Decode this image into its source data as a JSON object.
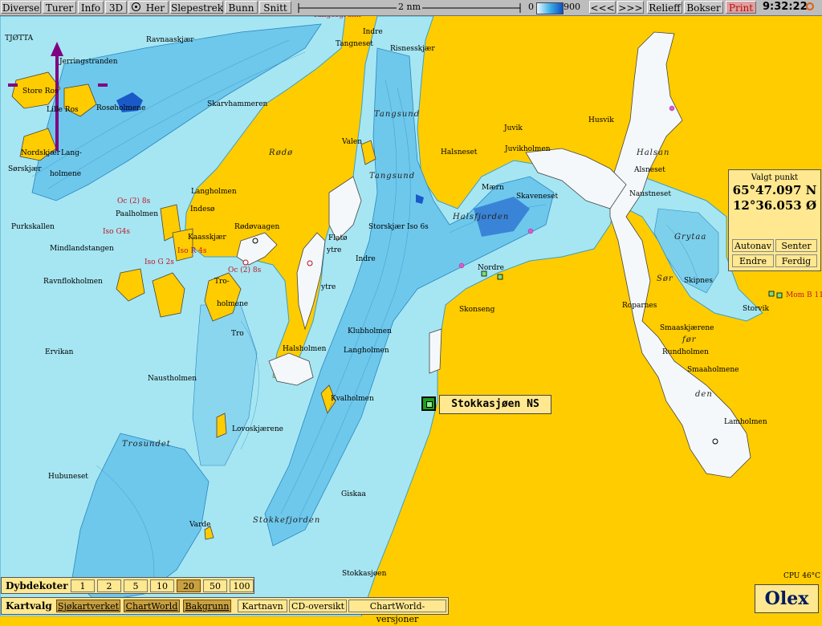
{
  "toolbar": {
    "items": [
      "Diverse",
      "Turer",
      "Info",
      "3D",
      "Her",
      "Slepestrek",
      "Bunn",
      "Snitt"
    ],
    "scale_label": "2 nm",
    "depth_min": "0",
    "depth_max": "900",
    "prev": "<<<",
    "next": ">>>",
    "relieff": "Relieff",
    "bokser": "Bokser",
    "print": "Print",
    "clock": "9:32:22"
  },
  "valgt_punkt": {
    "title": "Valgt punkt",
    "lat": "65°47.097 N",
    "lon": "12°36.053 Ø",
    "autonav": "Autonav",
    "senter": "Senter",
    "endre": "Endre",
    "ferdig": "Ferdig"
  },
  "waypoint": {
    "label": "Stokkasjøen NS"
  },
  "dybdekoter": {
    "label": "Dybdekoter",
    "values": [
      "1",
      "2",
      "5",
      "10",
      "20",
      "50",
      "100"
    ]
  },
  "kartvalg": {
    "label": "Kartvalg",
    "sources": [
      "Sjøkartverket",
      "ChartWorld",
      "Bakgrunn"
    ],
    "links": [
      "Kartnavn",
      "CD-oversikt",
      "ChartWorld-versjoner"
    ]
  },
  "cpu": "CPU 46°C",
  "logo": "Olex",
  "map_labels": [
    {
      "t": "TJØTTA",
      "s": "n"
    },
    {
      "t": "Ravnaaskjær",
      "s": "n"
    },
    {
      "t": "Indre",
      "s": "n"
    },
    {
      "t": "Tangneset",
      "s": "n"
    },
    {
      "t": "Risnesskjær",
      "s": "n"
    },
    {
      "t": "Jerringstranden",
      "s": "n"
    },
    {
      "t": "Store Ros",
      "s": "n"
    },
    {
      "t": "Lille Ros",
      "s": "n"
    },
    {
      "t": "Rosøholmene",
      "s": "n"
    },
    {
      "t": "Skarvhammeren",
      "s": "n"
    },
    {
      "t": "Tangsund",
      "s": "i"
    },
    {
      "t": "Juvik",
      "s": "n"
    },
    {
      "t": "Husvik",
      "s": "n"
    },
    {
      "t": "Nordskjær",
      "s": "n"
    },
    {
      "t": "Lang-",
      "s": "n"
    },
    {
      "t": "holmene",
      "s": "n"
    },
    {
      "t": "Sørskjær",
      "s": "n"
    },
    {
      "t": "Rødø",
      "s": "i"
    },
    {
      "t": "Valen",
      "s": "n"
    },
    {
      "t": "Halsneset",
      "s": "n"
    },
    {
      "t": "Juvikholmen",
      "s": "n"
    },
    {
      "t": "Halsan",
      "s": "i"
    },
    {
      "t": "Tangsund",
      "s": "i"
    },
    {
      "t": "Alsneset",
      "s": "n"
    },
    {
      "t": "Mærn",
      "s": "n"
    },
    {
      "t": "Skaveneset",
      "s": "n"
    },
    {
      "t": "Naustneset",
      "s": "n"
    },
    {
      "t": "Langholmen",
      "s": "n"
    },
    {
      "t": "Indesø",
      "s": "n"
    },
    {
      "t": "Paalholmen",
      "s": "n"
    },
    {
      "t": "Halsfjorden",
      "s": "i"
    },
    {
      "t": "Grytaa",
      "s": "i"
    },
    {
      "t": "Purkskallen",
      "s": "n"
    },
    {
      "t": "Rødøvaagen",
      "s": "n"
    },
    {
      "t": "Storskjær Iso 6s",
      "s": "n"
    },
    {
      "t": "Kaasskjær",
      "s": "n"
    },
    {
      "t": "Flatø",
      "s": "n"
    },
    {
      "t": "ytre",
      "s": "n"
    },
    {
      "t": "Mindlandstangen",
      "s": "n"
    },
    {
      "t": "Indre",
      "s": "n"
    },
    {
      "t": "Nordre",
      "s": "n"
    },
    {
      "t": "Ravnflokholmen",
      "s": "n"
    },
    {
      "t": "Tro-",
      "s": "n"
    },
    {
      "t": "holmene",
      "s": "n"
    },
    {
      "t": "Sør",
      "s": "i"
    },
    {
      "t": "Skipnes",
      "s": "n"
    },
    {
      "t": "ytre",
      "s": "n"
    },
    {
      "t": "Storvik",
      "s": "n"
    },
    {
      "t": "Skonseng",
      "s": "n"
    },
    {
      "t": "Roparnes",
      "s": "n"
    },
    {
      "t": "Tro",
      "s": "n"
    },
    {
      "t": "Klubholmen",
      "s": "n"
    },
    {
      "t": "Smaaskjærene",
      "s": "n"
    },
    {
      "t": "Ervikan",
      "s": "n"
    },
    {
      "t": "Halsholmen",
      "s": "n"
    },
    {
      "t": "Langholmen",
      "s": "n"
    },
    {
      "t": "før",
      "s": "i"
    },
    {
      "t": "Rundholmen",
      "s": "n"
    },
    {
      "t": "Naustholmen",
      "s": "n"
    },
    {
      "t": "Smaaholmene",
      "s": "n"
    },
    {
      "t": "Kvalholmen",
      "s": "n"
    },
    {
      "t": "den",
      "s": "i"
    },
    {
      "t": "Lamholmen",
      "s": "n"
    },
    {
      "t": "Lovoskjærene",
      "s": "n"
    },
    {
      "t": "Trosundet",
      "s": "i"
    },
    {
      "t": "Hubuneset",
      "s": "n"
    },
    {
      "t": "Giskaa",
      "s": "n"
    },
    {
      "t": "Stokkefjorden",
      "s": "i"
    },
    {
      "t": "Varde",
      "s": "n"
    },
    {
      "t": "Stokkasjøen",
      "s": "n"
    },
    {
      "t": "Oc (2) 8s",
      "s": "r"
    },
    {
      "t": "Iso G4s",
      "s": "r"
    },
    {
      "t": "Iso R 4s",
      "s": "r"
    },
    {
      "t": "Iso G 2s",
      "s": "r"
    },
    {
      "t": "Oc (2) 8s",
      "s": "r"
    },
    {
      "t": "Mom B 11",
      "s": "r"
    },
    {
      "t": "Tangesgrunn",
      "s": "r"
    }
  ]
}
